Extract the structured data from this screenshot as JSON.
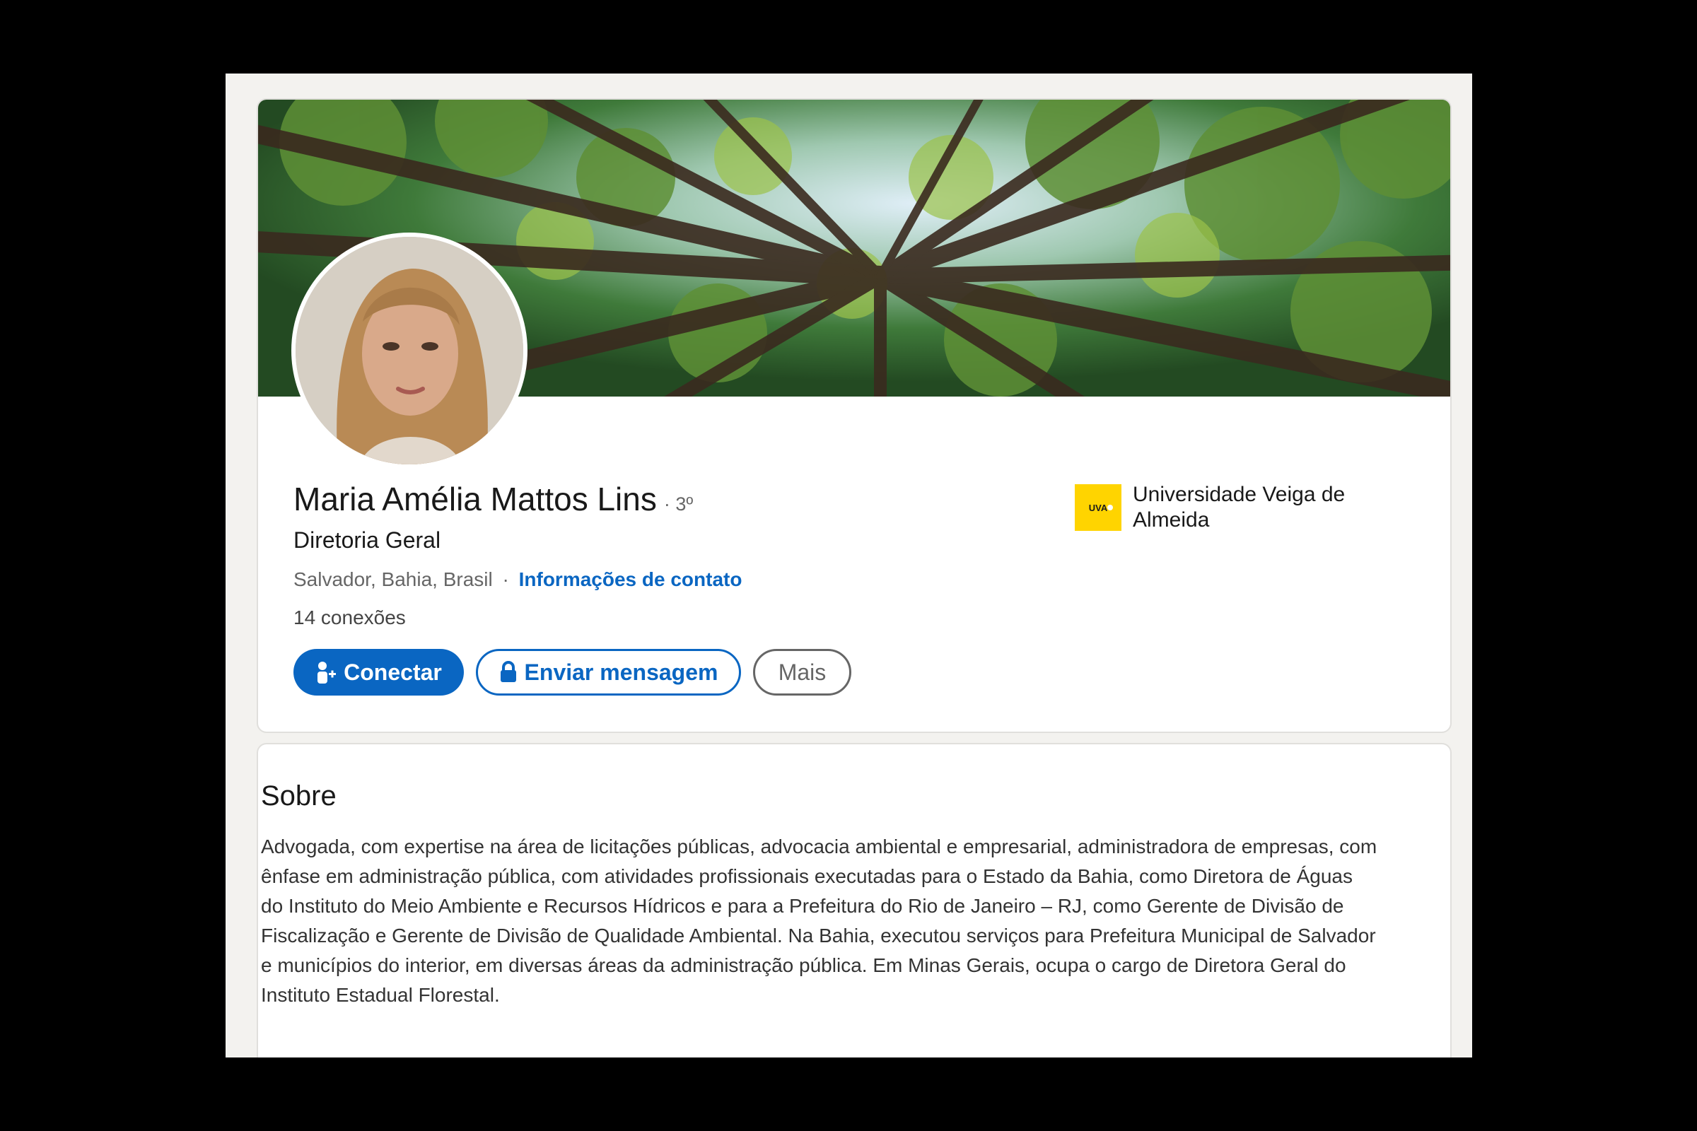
{
  "profile": {
    "name": "Maria Amélia Mattos Lins",
    "degree": "· 3º",
    "headline": "Diretoria Geral",
    "location": "Salvador, Bahia, Brasil",
    "separator": "·",
    "contact_link": "Informações de contato",
    "connections": "14 conexões"
  },
  "actions": {
    "connect_label": "Conectar",
    "message_label": "Enviar mensagem",
    "more_label": "Mais"
  },
  "education": {
    "logo_text": "UVA",
    "name": "Universidade Veiga de Almeida"
  },
  "about": {
    "title": "Sobre",
    "text": "Advogada, com expertise na área de licitações públicas, advocacia ambiental e empresarial, administradora de empresas, com ênfase em administração pública, com atividades profissionais executadas para o Estado da Bahia, como Diretora de Águas do Instituto do Meio Ambiente e Recursos Hídricos e para a Prefeitura do Rio de Janeiro – RJ, como Gerente de Divisão de Fiscalização e Gerente de Divisão de Qualidade Ambiental.  Na Bahia, executou serviços para Prefeitura Municipal de Salvador e municípios do interior, em diversas áreas da administração pública. Em Minas Gerais, ocupa o cargo de Diretora Geral do Instituto Estadual Florestal."
  },
  "colors": {
    "primary_blue": "#0a66c2",
    "page_background": "#f3f2ef",
    "card_background": "#ffffff",
    "logo_yellow": "#ffd400"
  },
  "icons": {
    "connect": "add-person-icon",
    "message": "lock-icon"
  }
}
